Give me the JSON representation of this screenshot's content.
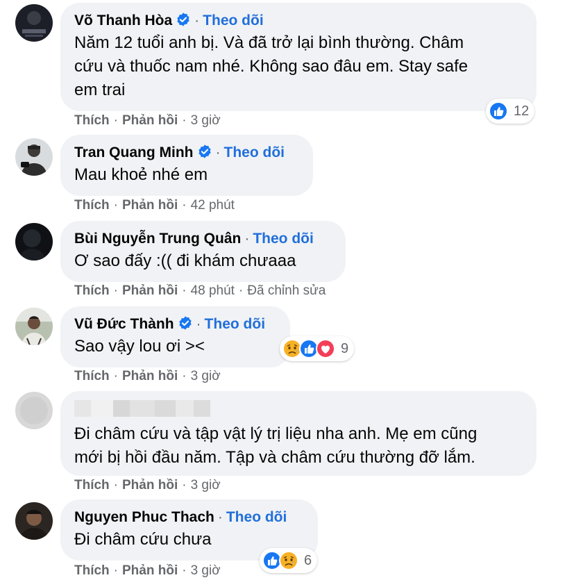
{
  "labels": {
    "like": "Thích",
    "reply": "Phản hồi",
    "follow": "Theo dõi",
    "edited": "Đã chỉnh sửa"
  },
  "comments": [
    {
      "name": "Võ Thanh Hòa",
      "verified": true,
      "text_lines": [
        "Năm 12 tuổi anh bị. Và đã trở lại bình thường. Châm",
        "cứu và thuốc nam nhé. Không sao đâu em. Stay safe",
        "em trai"
      ],
      "time": "3 giờ",
      "reactions": {
        "icons": [
          "like"
        ],
        "count": "12"
      }
    },
    {
      "name": "Tran Quang Minh",
      "verified": true,
      "text_lines": [
        "Mau khoẻ nhé em"
      ],
      "time": "42 phút"
    },
    {
      "name": "Bùi Nguyễn Trung Quân",
      "verified": false,
      "text_lines": [
        "Ơ sao đấy :(( đi khám chưaaa"
      ],
      "time": "48 phút",
      "edited": true
    },
    {
      "name": "Vũ Đức Thành",
      "verified": true,
      "text_lines": [
        "Sao vậy lou ơi ><"
      ],
      "time": "3 giờ",
      "reactions": {
        "icons": [
          "sad",
          "like",
          "love"
        ],
        "count": "9"
      }
    },
    {
      "name": "",
      "verified": false,
      "text_lines": [
        "Đi châm cứu và tập vật lý trị liệu nha anh. Mẹ em cũng",
        "mới bị hồi đầu năm. Tập và châm cứu thường đỡ lắm."
      ],
      "time": "3 giờ"
    },
    {
      "name": "Nguyen Phuc Thach",
      "verified": false,
      "text_lines": [
        "Đi châm cứu chưa"
      ],
      "time": "3 giờ",
      "reactions": {
        "icons": [
          "like",
          "sad"
        ],
        "count": "6"
      }
    }
  ],
  "colors": {
    "bubble": "#f0f2f5",
    "link": "#216fdb",
    "meta": "#65676b",
    "like": "#1877f2",
    "love": "#f33e58",
    "sad": "#f7b125"
  }
}
